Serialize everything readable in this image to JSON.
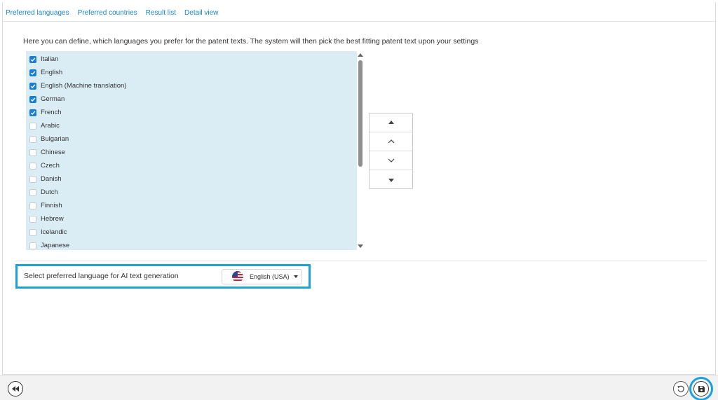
{
  "tabs": [
    {
      "label": "Preferred languages"
    },
    {
      "label": "Preferred countries"
    },
    {
      "label": "Result list"
    },
    {
      "label": "Detail view"
    }
  ],
  "intro_text": "Here you can define, which languages you prefer for the patent texts. The system will then pick the best fitting patent text upon your settings",
  "languages": [
    {
      "label": "Italian",
      "checked": true
    },
    {
      "label": "English",
      "checked": true
    },
    {
      "label": "English (Machine translation)",
      "checked": true
    },
    {
      "label": "German",
      "checked": true
    },
    {
      "label": "French",
      "checked": true
    },
    {
      "label": "Arabic",
      "checked": false
    },
    {
      "label": "Bulgarian",
      "checked": false
    },
    {
      "label": "Chinese",
      "checked": false
    },
    {
      "label": "Czech",
      "checked": false
    },
    {
      "label": "Danish",
      "checked": false
    },
    {
      "label": "Dutch",
      "checked": false
    },
    {
      "label": "Finnish",
      "checked": false
    },
    {
      "label": "Hebrew",
      "checked": false
    },
    {
      "label": "Icelandic",
      "checked": false
    },
    {
      "label": "Japanese",
      "checked": false
    }
  ],
  "ai_language": {
    "label": "Select preferred language for AI text generation",
    "selected": "English (USA)",
    "flag_icon": "us-flag-icon"
  },
  "move_buttons": [
    "move-to-top-icon",
    "move-up-icon",
    "move-down-icon",
    "move-to-bottom-icon"
  ],
  "footer_icons": {
    "back": "rewind-icon",
    "reset": "undo-icon",
    "save": "save-icon"
  },
  "colors": {
    "accent": "#1a88c9",
    "highlight": "#1ba1dd",
    "list_bg": "#daedf4",
    "checkbox": "#1a7fd1"
  }
}
